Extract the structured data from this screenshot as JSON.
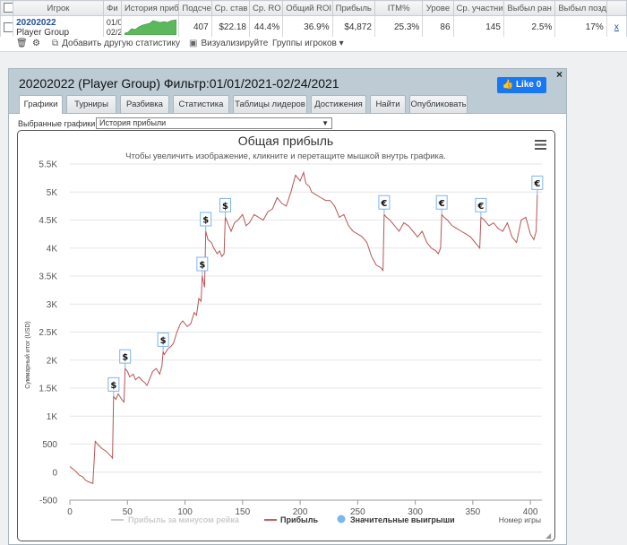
{
  "stats_table": {
    "headers": [
      "Игрок",
      "Фи",
      "История приб",
      "Подсче",
      "Ср. став",
      "Ср. RO",
      "Общий ROI",
      "Прибыль",
      "ITM%",
      "Урове",
      "Ср. участни",
      "Выбыл ран",
      "Выбыл позд"
    ],
    "row": {
      "player_name": "20202022",
      "player_group": "Player Group",
      "filter_line1": "01/0",
      "filter_line2": "02/2",
      "count": "407",
      "avg_stake": "$22.18",
      "avg_roi": "44.4%",
      "total_roi": "36.9%",
      "profit": "$4,872",
      "itm": "25.3%",
      "level": "86",
      "avg_entrants": "145",
      "early_out": "2.5%",
      "late_out": "17%",
      "close": "x"
    }
  },
  "toolbar": {
    "add_stat": "Добавить другую статистику",
    "visualize": "Визуализируйте",
    "player_groups": "Группы игроков"
  },
  "panel": {
    "title": "20202022 (Player Group) Фильтр:01/01/2021-02/24/2021",
    "like_label": "Like 0",
    "close": "×",
    "tabs": [
      "Графики",
      "Турниры",
      "Разбивка",
      "Статистика",
      "Таблицы лидеров",
      "Достижения",
      "Найти",
      "Опубликовать"
    ],
    "active_tab": 0,
    "select_label": "Выбранные графики:",
    "select_value": "История прибыли"
  },
  "chart_data": {
    "type": "line",
    "title": "Общая прибыль",
    "subtitle": "Чтобы увеличить изображение, кликните и перетащите мышкой внутрь графика.",
    "xlabel": "Номер игры",
    "ylabel": "Суммарный итог (USD)",
    "xlim": [
      0,
      410
    ],
    "ylim": [
      -500,
      5500
    ],
    "x_ticks": [
      "0",
      "50",
      "100",
      "150",
      "200",
      "250",
      "300",
      "350",
      "400"
    ],
    "y_ticks": [
      "-500",
      "0",
      "500",
      "1K",
      "1.5K",
      "2K",
      "2.5K",
      "3K",
      "3.5K",
      "4K",
      "4.5K",
      "5K",
      "5.5K"
    ],
    "legend": [
      "Прибыль за минусом рейка",
      "Прибыль",
      "Значительные выигрыши"
    ],
    "legend_colors": [
      "#cccccc",
      "#c46060",
      "#7cb5ec"
    ],
    "line_color": "#b65555",
    "series": [
      {
        "name": "Прибыль",
        "x": [
          0,
          3,
          5,
          8,
          11,
          14,
          17,
          20,
          22,
          25,
          28,
          31,
          34,
          36,
          37,
          38,
          40,
          42,
          45,
          47,
          48,
          50,
          52,
          55,
          57,
          60,
          62,
          65,
          67,
          68,
          70,
          72,
          75,
          78,
          80,
          81,
          82,
          85,
          88,
          90,
          93,
          96,
          98,
          100,
          102,
          105,
          108,
          110,
          112,
          114,
          115,
          116,
          117,
          118,
          120,
          123,
          125,
          128,
          130,
          132,
          134,
          135,
          136,
          138,
          140,
          143,
          146,
          150,
          153,
          156,
          160,
          164,
          168,
          172,
          176,
          180,
          184,
          188,
          192,
          196,
          200,
          203,
          205,
          208,
          210,
          214,
          218,
          222,
          226,
          230,
          234,
          238,
          242,
          246,
          250,
          254,
          258,
          262,
          266,
          270,
          272,
          273,
          275,
          278,
          282,
          286,
          290,
          294,
          298,
          302,
          306,
          310,
          314,
          318,
          320,
          322,
          323,
          325,
          328,
          332,
          336,
          340,
          344,
          348,
          352,
          354,
          356,
          357,
          360,
          364,
          368,
          372,
          376,
          380,
          384,
          388,
          392,
          396,
          398,
          400,
          403,
          405,
          406
        ],
        "y": [
          100,
          50,
          20,
          -50,
          -80,
          -150,
          -180,
          -200,
          550,
          480,
          420,
          380,
          320,
          280,
          250,
          1350,
          1300,
          1400,
          1300,
          1250,
          1850,
          1800,
          1700,
          1750,
          1650,
          1700,
          1650,
          1600,
          1550,
          1600,
          1700,
          1800,
          1850,
          1750,
          1900,
          2150,
          2100,
          2200,
          2250,
          2300,
          2500,
          2650,
          2700,
          2650,
          2600,
          2650,
          2850,
          2800,
          3100,
          3050,
          3500,
          3400,
          3300,
          4300,
          4150,
          4100,
          4000,
          3900,
          3950,
          3850,
          3900,
          4550,
          4500,
          4400,
          4300,
          4450,
          4500,
          4600,
          4400,
          4450,
          4600,
          4550,
          4500,
          4650,
          4700,
          4900,
          4800,
          4750,
          5000,
          5300,
          5200,
          5350,
          5150,
          5100,
          5000,
          4950,
          4900,
          4850,
          4850,
          4750,
          4550,
          4600,
          4400,
          4300,
          4250,
          4200,
          4100,
          3850,
          3700,
          3650,
          3600,
          4600,
          4550,
          4500,
          4400,
          4300,
          4450,
          4400,
          4300,
          4200,
          4300,
          4100,
          4000,
          3950,
          3900,
          4000,
          4600,
          4550,
          4500,
          4400,
          4350,
          4300,
          4250,
          4200,
          4100,
          4050,
          4000,
          4550,
          4500,
          4400,
          4450,
          4350,
          4300,
          4450,
          4200,
          4100,
          4500,
          4550,
          4400,
          4250,
          4150,
          4300,
          4950
        ]
      }
    ],
    "big_wins": [
      {
        "x": 38,
        "y": 1350,
        "symbol": "$"
      },
      {
        "x": 48,
        "y": 1850,
        "symbol": "$"
      },
      {
        "x": 81,
        "y": 2150,
        "symbol": "$"
      },
      {
        "x": 115,
        "y": 3500,
        "symbol": "$"
      },
      {
        "x": 118,
        "y": 4300,
        "symbol": "$"
      },
      {
        "x": 135,
        "y": 4550,
        "symbol": "$"
      },
      {
        "x": 273,
        "y": 4600,
        "symbol": "€"
      },
      {
        "x": 323,
        "y": 4600,
        "symbol": "€"
      },
      {
        "x": 357,
        "y": 4550,
        "symbol": "€"
      },
      {
        "x": 406,
        "y": 4950,
        "symbol": "€"
      }
    ],
    "grid": "horizontal"
  }
}
